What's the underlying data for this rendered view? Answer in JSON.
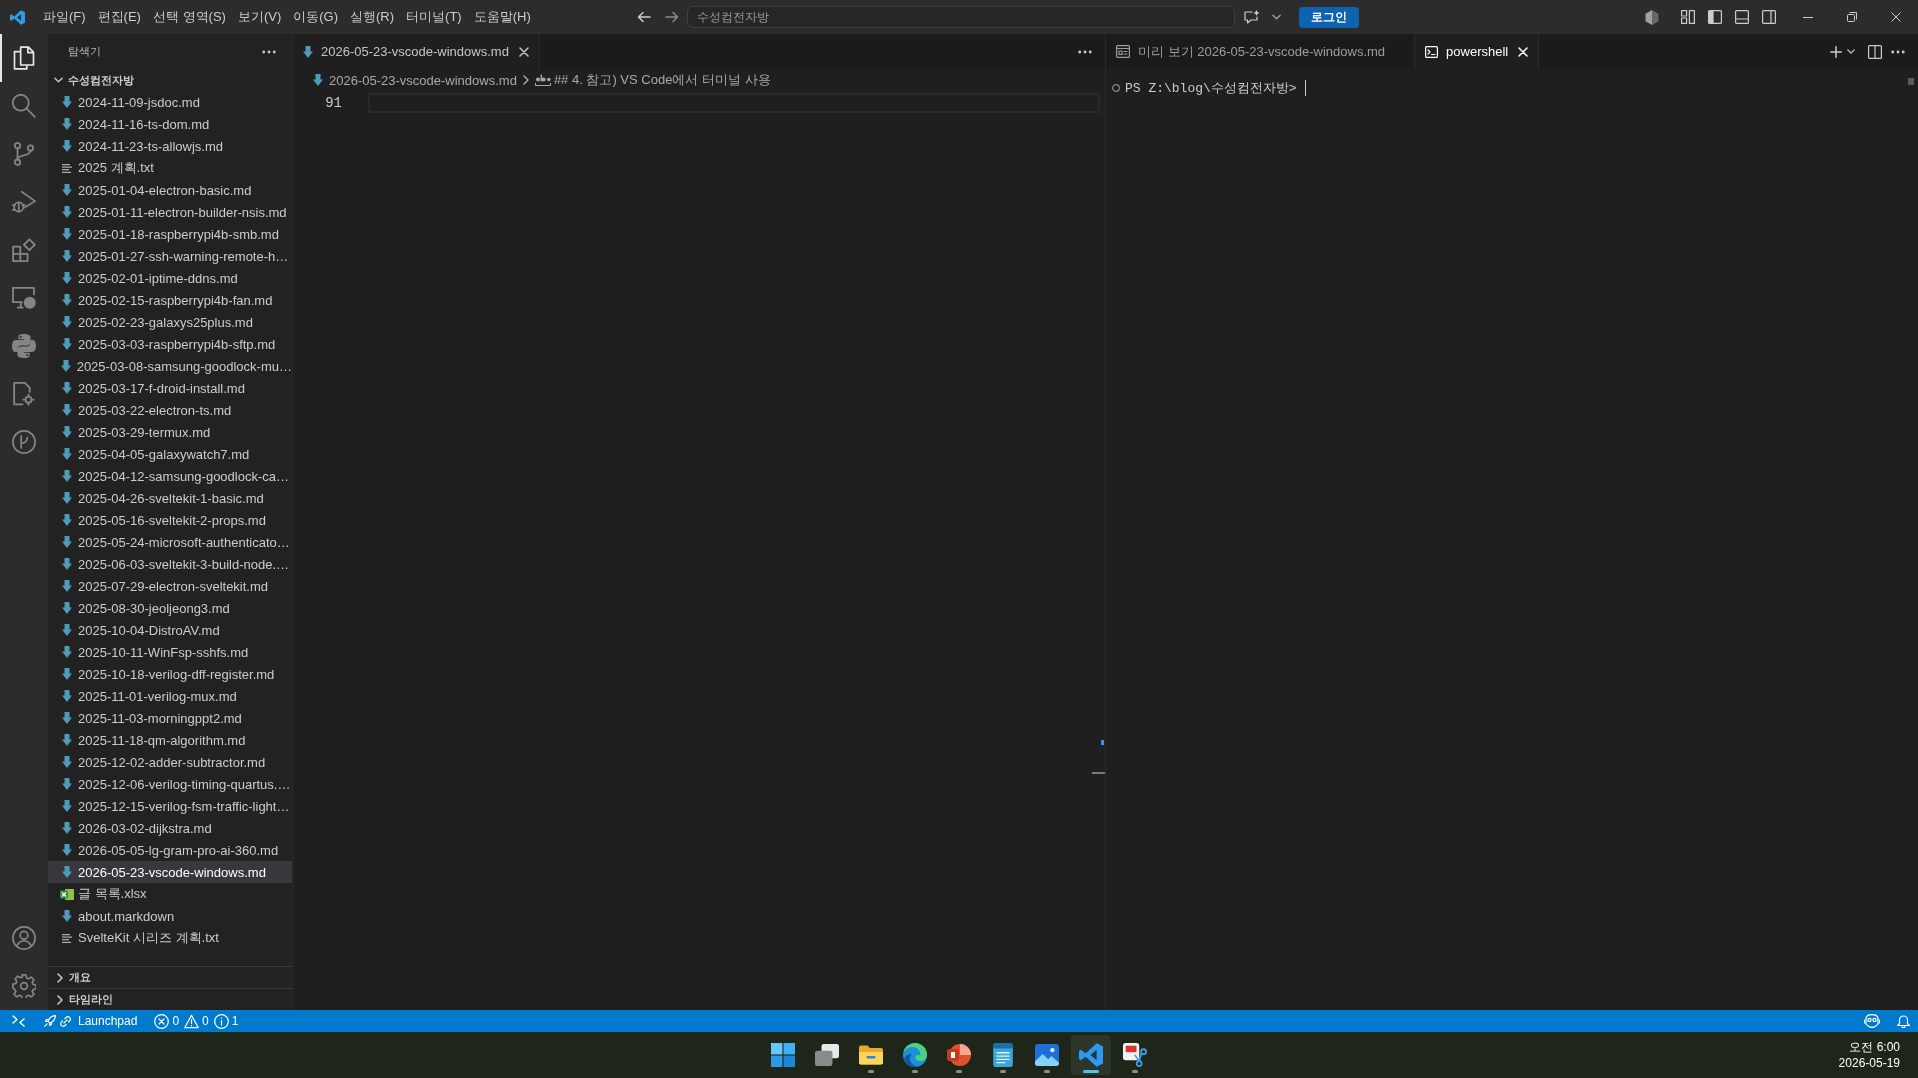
{
  "title_bar": {
    "menu": [
      "파일(F)",
      "편집(E)",
      "선택 영역(S)",
      "보기(V)",
      "이동(G)",
      "실행(R)",
      "터미널(T)",
      "도움말(H)"
    ],
    "command_center": {
      "label": "수성컴전자방"
    },
    "login_button": {
      "label": "로그인"
    }
  },
  "activity_bar": {
    "items": [
      {
        "kind": "explorer",
        "selected": true
      },
      {
        "kind": "search",
        "selected": false
      },
      {
        "kind": "source_control",
        "selected": false
      },
      {
        "kind": "run_debug",
        "selected": false
      },
      {
        "kind": "extensions",
        "selected": false
      },
      {
        "kind": "remote",
        "selected": false
      },
      {
        "kind": "python",
        "selected": false
      },
      {
        "kind": "file_gear",
        "selected": false
      },
      {
        "kind": "branch_circle",
        "selected": false
      }
    ],
    "bottom": [
      {
        "kind": "account"
      },
      {
        "kind": "settings"
      }
    ]
  },
  "sidebar": {
    "title": "탐색기",
    "folder": {
      "name": "수성컴전자방",
      "expanded": true,
      "children": [
        {
          "name": "2024-11-09-jsdoc.md",
          "kind": "markdown",
          "selected": false
        },
        {
          "name": "2024-11-16-ts-dom.md",
          "kind": "markdown",
          "selected": false
        },
        {
          "name": "2024-11-23-ts-allowjs.md",
          "kind": "markdown",
          "selected": false
        },
        {
          "name": "2025 계획.txt",
          "kind": "text",
          "selected": false
        },
        {
          "name": "2025-01-04-electron-basic.md",
          "kind": "markdown",
          "selected": false
        },
        {
          "name": "2025-01-11-electron-builder-nsis.md",
          "kind": "markdown",
          "selected": false
        },
        {
          "name": "2025-01-18-raspberrypi4b-smb.md",
          "kind": "markdown",
          "selected": false
        },
        {
          "name": "2025-01-27-ssh-warning-remote-h…",
          "kind": "markdown",
          "selected": false
        },
        {
          "name": "2025-02-01-iptime-ddns.md",
          "kind": "markdown",
          "selected": false
        },
        {
          "name": "2025-02-15-raspberrypi4b-fan.md",
          "kind": "markdown",
          "selected": false
        },
        {
          "name": "2025-02-23-galaxys25plus.md",
          "kind": "markdown",
          "selected": false
        },
        {
          "name": "2025-03-03-raspberrypi4b-sftp.md",
          "kind": "markdown",
          "selected": false
        },
        {
          "name": "2025-03-08-samsung-goodlock-mu…",
          "kind": "markdown",
          "selected": false
        },
        {
          "name": "2025-03-17-f-droid-install.md",
          "kind": "markdown",
          "selected": false
        },
        {
          "name": "2025-03-22-electron-ts.md",
          "kind": "markdown",
          "selected": false
        },
        {
          "name": "2025-03-29-termux.md",
          "kind": "markdown",
          "selected": false
        },
        {
          "name": "2025-04-05-galaxywatch7.md",
          "kind": "markdown",
          "selected": false
        },
        {
          "name": "2025-04-12-samsung-goodlock-ca…",
          "kind": "markdown",
          "selected": false
        },
        {
          "name": "2025-04-26-sveltekit-1-basic.md",
          "kind": "markdown",
          "selected": false
        },
        {
          "name": "2025-05-16-sveltekit-2-props.md",
          "kind": "markdown",
          "selected": false
        },
        {
          "name": "2025-05-24-microsoft-authenticato…",
          "kind": "markdown",
          "selected": false
        },
        {
          "name": "2025-06-03-sveltekit-3-build-node.…",
          "kind": "markdown",
          "selected": false
        },
        {
          "name": "2025-07-29-electron-sveltekit.md",
          "kind": "markdown",
          "selected": false
        },
        {
          "name": "2025-08-30-jeoljeong3.md",
          "kind": "markdown",
          "selected": false
        },
        {
          "name": "2025-10-04-DistroAV.md",
          "kind": "markdown",
          "selected": false
        },
        {
          "name": "2025-10-11-WinFsp-sshfs.md",
          "kind": "markdown",
          "selected": false
        },
        {
          "name": "2025-10-18-verilog-dff-register.md",
          "kind": "markdown",
          "selected": false
        },
        {
          "name": "2025-11-01-verilog-mux.md",
          "kind": "markdown",
          "selected": false
        },
        {
          "name": "2025-11-03-morningppt2.md",
          "kind": "markdown",
          "selected": false
        },
        {
          "name": "2025-11-18-qm-algorithm.md",
          "kind": "markdown",
          "selected": false
        },
        {
          "name": "2025-12-02-adder-subtractor.md",
          "kind": "markdown",
          "selected": false
        },
        {
          "name": "2025-12-06-verilog-timing-quartus.…",
          "kind": "markdown",
          "selected": false
        },
        {
          "name": "2025-12-15-verilog-fsm-traffic-light…",
          "kind": "markdown",
          "selected": false
        },
        {
          "name": "2026-03-02-dijkstra.md",
          "kind": "markdown",
          "selected": false
        },
        {
          "name": "2026-05-05-lg-gram-pro-ai-360.md",
          "kind": "markdown",
          "selected": false
        },
        {
          "name": "2026-05-23-vscode-windows.md",
          "kind": "markdown",
          "selected": true
        },
        {
          "name": "글 목록.xlsx",
          "kind": "spreadsheet",
          "selected": false
        },
        {
          "name": "about.markdown",
          "kind": "markdown",
          "selected": false
        },
        {
          "name": "SvelteKit 시리즈 계획.txt",
          "kind": "text",
          "selected": false
        }
      ]
    },
    "sections": [
      {
        "label": "개요",
        "expanded": false
      },
      {
        "label": "타임라인",
        "expanded": false
      }
    ]
  },
  "editor_groups": [
    {
      "focused": false,
      "tabs": [
        {
          "label": "2026-05-23-vscode-windows.md",
          "kind": "markdown",
          "selected": true
        }
      ],
      "breadcrumbs": [
        {
          "label": "2026-05-23-vscode-windows.md",
          "kind": "markdown"
        },
        {
          "label": "## 4. 참고) VS Code에서 터미널 사용",
          "kind": "string"
        }
      ],
      "editor": {
        "line_number": "91"
      }
    },
    {
      "focused": true,
      "tabs": [
        {
          "label": "미리 보기 2026-05-23-vscode-windows.md",
          "kind": "preview",
          "selected": false
        },
        {
          "label": "powershell",
          "kind": "terminal",
          "selected": true
        }
      ],
      "terminal": {
        "prompt": "PS Z:\\blog\\수성컴전자방>"
      }
    }
  ],
  "status_bar": {
    "launchpad": {
      "label": "Launchpad"
    },
    "problems": [
      {
        "kind": "error",
        "count": "0"
      },
      {
        "kind": "warning",
        "count": "0"
      },
      {
        "kind": "info",
        "count": "1"
      }
    ]
  },
  "taskbar": {
    "apps": [
      {
        "kind": "start",
        "running": false,
        "selected": false
      },
      {
        "kind": "task_view",
        "running": false,
        "selected": false
      },
      {
        "kind": "file_explorer",
        "running": true,
        "selected": false
      },
      {
        "kind": "browser",
        "running": true,
        "selected": false
      },
      {
        "kind": "presentation",
        "running": true,
        "selected": false
      },
      {
        "kind": "notepad",
        "running": true,
        "selected": false
      },
      {
        "kind": "photos",
        "running": true,
        "selected": false
      },
      {
        "kind": "code_editor",
        "running": true,
        "selected": true
      },
      {
        "kind": "snipping_tool",
        "running": true,
        "selected": false
      }
    ],
    "clock": {
      "time": "오전 6:00",
      "date": "2026-05-19"
    }
  }
}
